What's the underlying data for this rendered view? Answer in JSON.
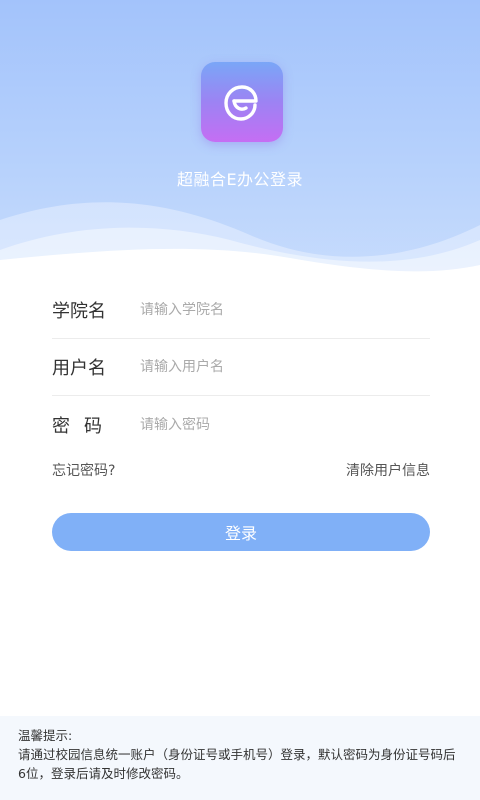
{
  "header": {
    "app_title": "超融合E办公登录"
  },
  "form": {
    "college": {
      "label": "学院名",
      "placeholder": "请输入学院名"
    },
    "username": {
      "label": "用户名",
      "placeholder": "请输入用户名"
    },
    "password": {
      "label": "密码",
      "placeholder": "请输入密码"
    }
  },
  "links": {
    "forgot": "忘记密码?",
    "clear": "清除用户信息"
  },
  "login_button": "登录",
  "tips": {
    "title": "温馨提示:",
    "text": "请通过校园信息统一账户（身份证号或手机号）登录，默认密码为身份证号码后6位，登录后请及时修改密码。"
  },
  "colors": {
    "header_top": "#a3c3fb",
    "button": "#80b0f7",
    "logo_gradient_top": "#7aa6f7",
    "logo_gradient_bottom": "#c56ef3"
  }
}
